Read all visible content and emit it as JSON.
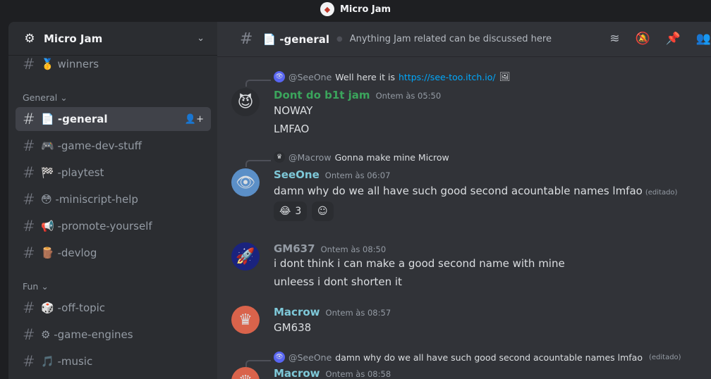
{
  "window": {
    "title": "Micro Jam"
  },
  "server": {
    "name": "Micro Jam"
  },
  "sidebar": {
    "channels_top": [
      {
        "label": "🥇 winners"
      }
    ],
    "categories": [
      {
        "label": "General ⌄"
      },
      {
        "label": "Fun ⌄"
      }
    ],
    "general_channels": [
      {
        "label": "📄 -general",
        "active": true
      },
      {
        "label": "🎮 -game-dev-stuff"
      },
      {
        "label": "🏁 -playtest"
      },
      {
        "label": "😳 -miniscript-help"
      },
      {
        "label": "📢 -promote-yourself"
      },
      {
        "label": "🪵 -devlog"
      }
    ],
    "fun_channels": [
      {
        "label": "🎲 -off-topic"
      },
      {
        "label": "⚙ -game-engines"
      },
      {
        "label": "🎵 -music"
      }
    ]
  },
  "channel": {
    "name": "📄 -general",
    "topic": "Anything Jam related can be discussed here"
  },
  "messages": [
    {
      "reply": {
        "who": "@SeeOne",
        "text": "Well here it is",
        "link": "https://see-too.itch.io/"
      },
      "author": "Dont do b1t jam",
      "author_color": "#3ba55c",
      "time": "Ontem às 05:50",
      "lines": [
        "NOWAY",
        "LMFAO"
      ]
    },
    {
      "reply": {
        "who": "@Macrow",
        "text": "Gonna make mine Microw"
      },
      "author": "SeeOne",
      "author_color": "#7ec8d8",
      "time": "Ontem às 06:07",
      "lines": [
        "damn why do we all have such good second acountable names lmfao"
      ],
      "edited": "(editado)",
      "reaction": {
        "emoji": "😂",
        "count": "3"
      }
    },
    {
      "author": "GM637",
      "author_color": "#949ba4",
      "time": "Ontem às 08:50",
      "lines": [
        "i dont think i can make a good second name with mine",
        "unleess i dont shorten it"
      ]
    },
    {
      "author": "Macrow",
      "author_color": "#7ec8d8",
      "time": "Ontem às 08:57",
      "lines": [
        "GM638"
      ]
    },
    {
      "reply": {
        "who": "@SeeOne",
        "text": "damn why do we all have such good second acountable names lmfao",
        "edited": "(editado)"
      },
      "author": "Macrow",
      "author_color": "#7ec8d8",
      "time": "Ontem às 08:58"
    }
  ]
}
